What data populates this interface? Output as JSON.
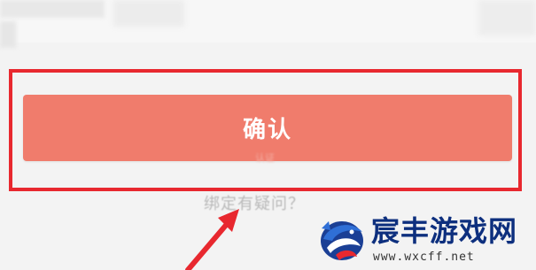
{
  "confirm_button": {
    "label": "确认"
  },
  "faint_text": "认证",
  "help_link": {
    "label": "绑定有疑问？"
  },
  "watermark": {
    "title": "宸丰游戏网",
    "url": "www.wxcff.net"
  },
  "colors": {
    "button_bg": "#f07c6c",
    "highlight_border": "#e8282f",
    "arrow": "#e8282f",
    "watermark_text": "#0d2f7e"
  }
}
